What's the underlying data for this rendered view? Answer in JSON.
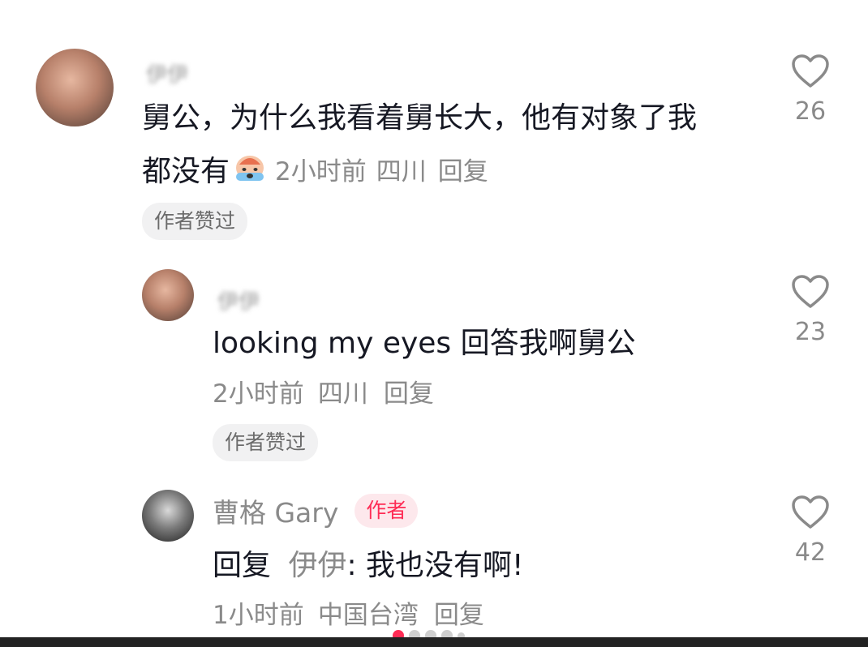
{
  "comments": [
    {
      "username": "伊伊",
      "text_line1": "舅公，为什么我看着舅长大，他有对象了我",
      "text_line2": "都没有",
      "emoji": "crying-face-emoji",
      "time": "2小时前",
      "location": "四川",
      "reply_label": "回复",
      "author_liked": "作者赞过",
      "likes": "26"
    },
    {
      "username": "伊伊",
      "text": "looking my eyes 回答我啊舅公",
      "time": "2小时前",
      "location": "四川",
      "reply_label": "回复",
      "author_liked": "作者赞过",
      "likes": "23"
    },
    {
      "username": "曹格 Gary",
      "badge": "作者",
      "reply_prefix": "回复",
      "reply_to": "伊伊",
      "text": ": 我也没有啊!",
      "time": "1小时前",
      "location": "中国台湾",
      "reply_label": "回复",
      "likes": "42"
    }
  ],
  "icons": {
    "like": "heart-outline-icon"
  },
  "colors": {
    "accent": "#fe2c55",
    "muted": "#8a8a8a",
    "chip_bg": "#f1f1f2"
  },
  "pager": {
    "count": 5,
    "active": 0
  }
}
